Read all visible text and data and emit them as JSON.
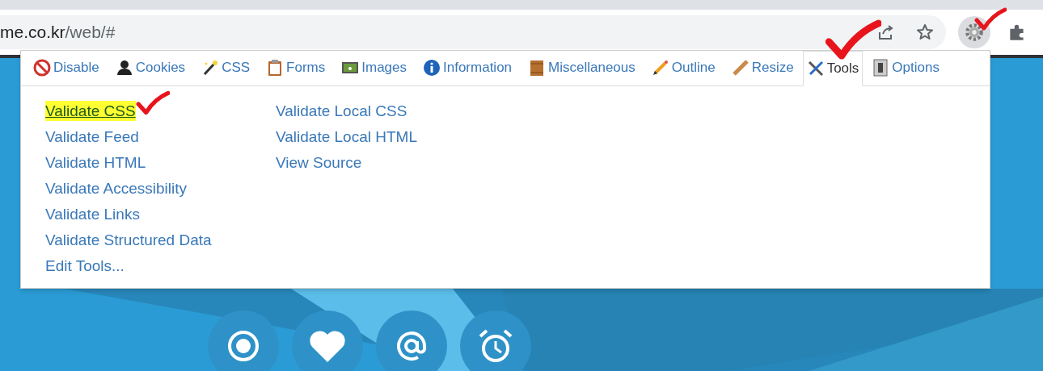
{
  "address_bar": {
    "host": "me.co.kr",
    "path": "/web/#"
  },
  "tabs": [
    {
      "label": "Disable",
      "selected": false
    },
    {
      "label": "Cookies",
      "selected": false
    },
    {
      "label": "CSS",
      "selected": false
    },
    {
      "label": "Forms",
      "selected": false
    },
    {
      "label": "Images",
      "selected": false
    },
    {
      "label": "Information",
      "selected": false
    },
    {
      "label": "Miscellaneous",
      "selected": false
    },
    {
      "label": "Outline",
      "selected": false
    },
    {
      "label": "Resize",
      "selected": false
    },
    {
      "label": "Tools",
      "selected": true
    },
    {
      "label": "Options",
      "selected": false
    }
  ],
  "menu_columns": [
    [
      {
        "label": "Validate CSS",
        "highlighted": true
      },
      {
        "label": "Validate Feed",
        "highlighted": false
      },
      {
        "label": "Validate HTML",
        "highlighted": false
      },
      {
        "label": "Validate Accessibility",
        "highlighted": false
      },
      {
        "label": "Validate Links",
        "highlighted": false
      },
      {
        "label": "Validate Structured Data",
        "highlighted": false
      },
      {
        "label": "Edit Tools...",
        "highlighted": false
      }
    ],
    [
      {
        "label": "Validate Local CSS",
        "highlighted": false
      },
      {
        "label": "Validate Local HTML",
        "highlighted": false
      },
      {
        "label": "View Source",
        "highlighted": false
      }
    ]
  ]
}
